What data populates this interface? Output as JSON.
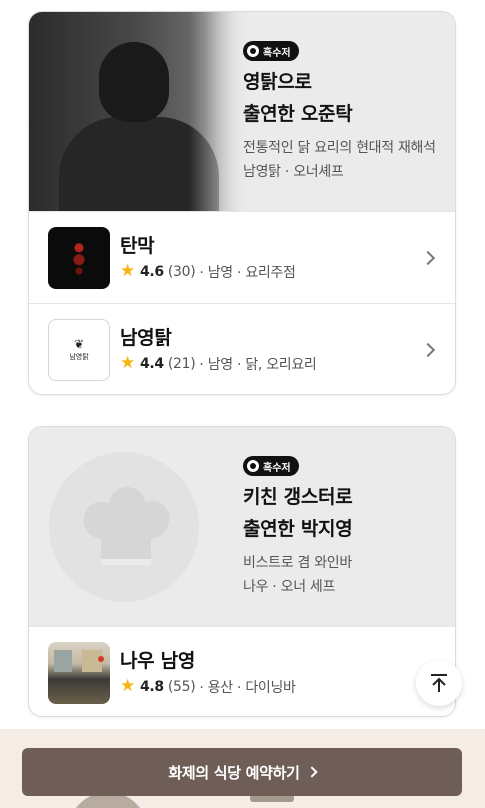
{
  "cards": [
    {
      "badge": "흑수저",
      "title_line1": "영탉으로",
      "title_line2": "출연한 오준탁",
      "desc_line1": "전통적인 닭 요리의 현대적 재해석",
      "desc_line2": "남영탉 · 오너셰프",
      "restaurants": [
        {
          "name": "탄막",
          "rating": "4.6",
          "count": "(30)",
          "details": "· 남영 · 요리주점"
        },
        {
          "name": "남영탉",
          "rating": "4.4",
          "count": "(21)",
          "details": "· 남영 · 닭, 오리요리",
          "logo_word": "남영탉"
        }
      ]
    },
    {
      "badge": "흑수저",
      "title_line1": "키친 갱스터로",
      "title_line2": "출연한 박지영",
      "desc_line1": "비스트로 겸 와인바",
      "desc_line2": "나우 · 오너 세프",
      "restaurants": [
        {
          "name": "나우 남영",
          "rating": "4.8",
          "count": "(55)",
          "details": "· 용산 · 다이닝바"
        }
      ]
    }
  ],
  "cta": {
    "label": "화제의 식당 예약하기"
  },
  "icons": {
    "star": "star-icon",
    "chevron": "chevron-right-icon",
    "scroll_top": "arrow-up-to-top-icon",
    "chef_hat": "chef-hat-icon"
  },
  "colors": {
    "star": "#f6b40e",
    "cta_bg": "#6f5e57",
    "bottom_bar": "#f5ede5",
    "badge_bg": "#111111"
  }
}
